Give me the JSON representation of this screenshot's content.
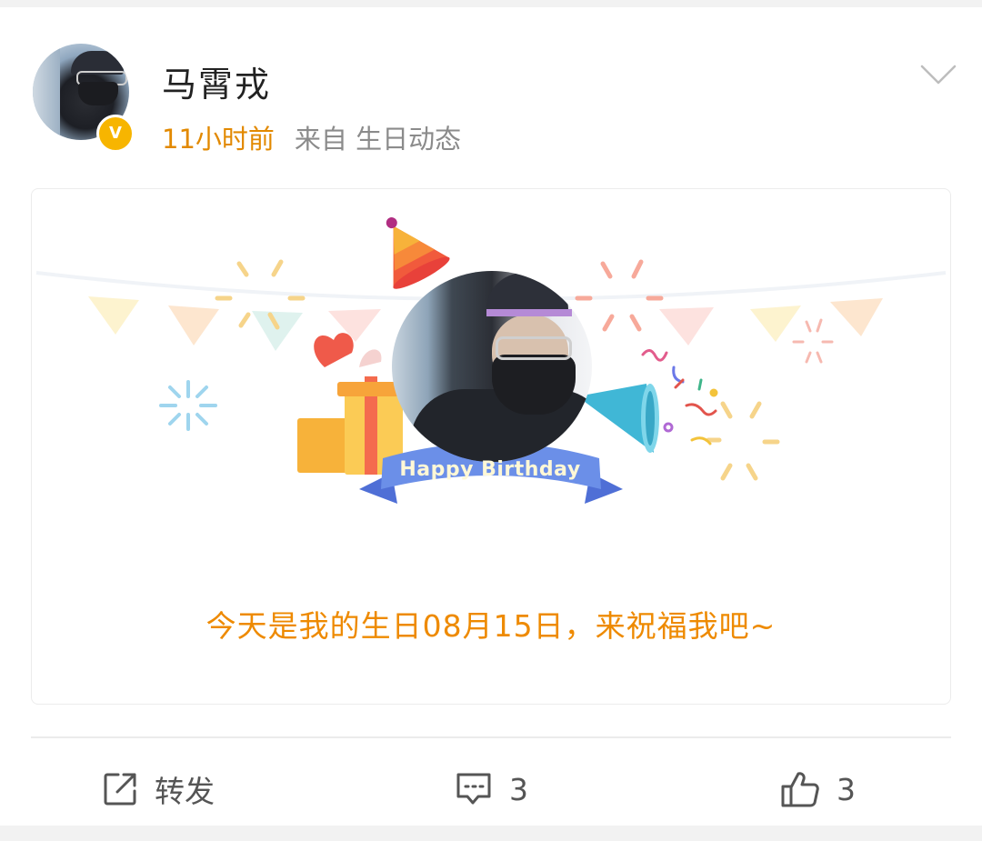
{
  "post": {
    "author_name": "马霄戎",
    "verified_mark": "V",
    "time": "11小时前",
    "source": "来自 生日动态"
  },
  "birthday_card": {
    "ribbon_text": "Happy Birthday",
    "message": "今天是我的生日08月15日，来祝福我吧~"
  },
  "actions": {
    "repost_label": "转发",
    "comment_count": "3",
    "like_count": "3"
  },
  "colors": {
    "time_accent": "#e28900",
    "message_accent": "#ee8a00",
    "verified_badge": "#f7b500",
    "ribbon": "#6b8fe8"
  },
  "icons": {
    "menu": "chevron-down-icon",
    "repost": "share-icon",
    "comment": "comment-icon",
    "like": "thumbs-up-icon"
  }
}
